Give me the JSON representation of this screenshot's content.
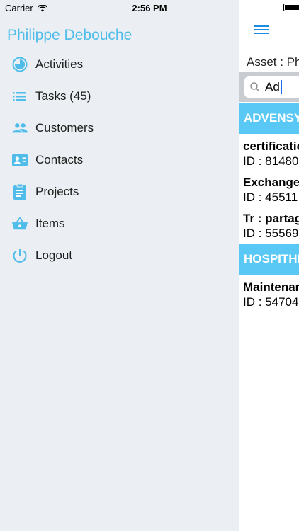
{
  "status_bar": {
    "carrier": "Carrier",
    "time": "2:56 PM"
  },
  "menu": {
    "user_name": "Philippe Debouche",
    "items": [
      {
        "label": "Activities",
        "icon": "clock-icon"
      },
      {
        "label": "Tasks (45)",
        "icon": "list-icon"
      },
      {
        "label": "Customers",
        "icon": "people-icon"
      },
      {
        "label": "Contacts",
        "icon": "contact-card-icon"
      },
      {
        "label": "Projects",
        "icon": "clipboard-icon"
      },
      {
        "label": "Items",
        "icon": "basket-icon"
      },
      {
        "label": "Logout",
        "icon": "power-icon"
      }
    ]
  },
  "main": {
    "asset_label": "Asset : Ph",
    "search": {
      "value": "Ad"
    },
    "sections": [
      {
        "header": "ADVENSY",
        "items": [
          {
            "title": "certificatio",
            "sub": "ID : 81480"
          },
          {
            "title": "Exchange",
            "sub": "ID : 45511"
          },
          {
            "title": "Tr : partag",
            "sub": "ID : 55569"
          }
        ]
      },
      {
        "header": "HOSPITHE",
        "items": [
          {
            "title": "Maintenan",
            "sub": "ID : 54704"
          }
        ]
      }
    ]
  },
  "colors": {
    "accent": "#4fbcea",
    "section_header": "#5ac8f5",
    "hamburger": "#1a8fe0",
    "menu_bg": "#ebeff3"
  }
}
